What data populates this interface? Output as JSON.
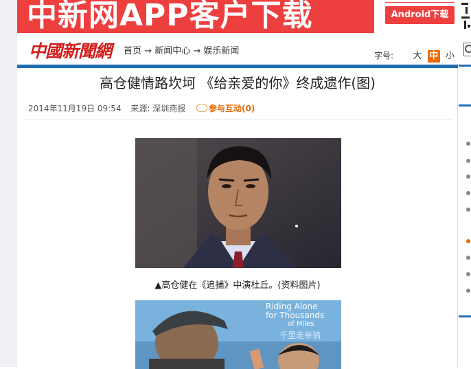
{
  "banner": {
    "text": "中新网APP客户下载",
    "android_button": "Android下载"
  },
  "header": {
    "logo": "中國新聞網",
    "breadcrumb": {
      "home": "首页",
      "arrow": "→",
      "news_center": "新闻中心",
      "entertainment": "娱乐新闻"
    },
    "font_size": {
      "label": "字号:",
      "large": "大",
      "medium": "中",
      "small": "小",
      "selected": "中"
    }
  },
  "article": {
    "title": "高仓健情路坎坷 《给亲爱的你》终成遗作(图)",
    "date": "2014年11月19日 09:54",
    "source_label": "来源:",
    "source": "深圳商报",
    "comment_link": "参与互动(0)",
    "photo1_caption": "▲高仓健在《追捕》中演杜丘。(资料图片)",
    "photo2_poster_text": [
      "Riding Alone",
      "for Thousands",
      "of Miles"
    ]
  },
  "colors": {
    "brand_red": "#ee3f3f",
    "accent_blue": "#1f6db2",
    "comment_orange": "#e86a00",
    "font_selected_bg": "#ec6a00"
  }
}
